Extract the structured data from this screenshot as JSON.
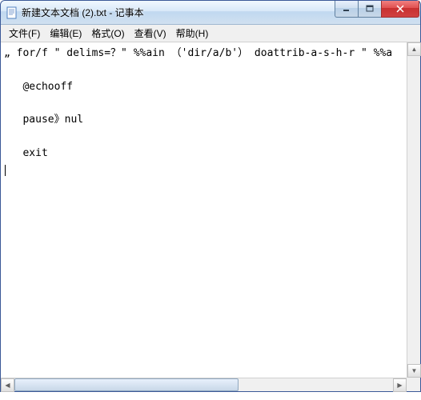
{
  "window": {
    "title": "新建文本文档 (2).txt - 记事本"
  },
  "menu": {
    "file": "文件(F)",
    "edit": "编辑(E)",
    "format": "格式(O)",
    "view": "查看(V)",
    "help": "帮助(H)"
  },
  "content": {
    "line1": "„ for/f \" delims=？\" %%ain （'dir/a/b'） doattrib-a-s-h-r \" %%a",
    "line2": "",
    "line3": "   @echooff",
    "line4": "",
    "line5": "   pause》nul",
    "line6": "",
    "line7": "   exit"
  },
  "icons": {
    "app": "notepad-icon",
    "min": "minimize",
    "max": "maximize",
    "close": "close"
  }
}
